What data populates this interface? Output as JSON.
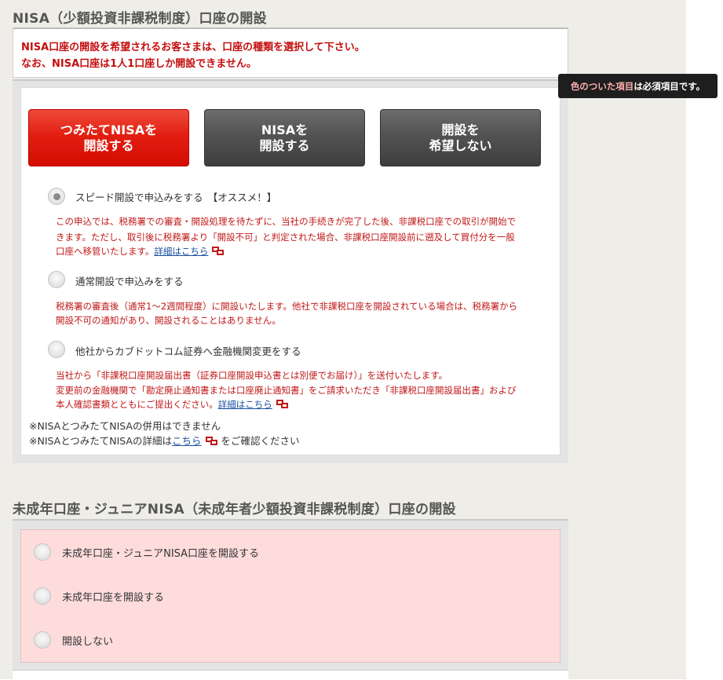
{
  "nisa_section": {
    "title": "NISA（少額投資非課税制度）口座の開設",
    "notice_line1": "NISA口座の開設を希望されるお客さまは、口座の種類を選択して下さい。",
    "notice_line2": "なお、NISA口座は1人1口座しか開設できません。",
    "buttons": {
      "tsumitate": "つみたてNISAを\n開設する",
      "nisa": "NISAを\n開設する",
      "none": "開設を\n希望しない"
    },
    "options": [
      {
        "label": "スピード開設で申込みをする　【オススメ！】",
        "checked": true,
        "desc_lines": [
          "この申込では、税務署での審査・開設処理を待たずに、当社の手続きが完了した後、非課税口座での取引が開始で",
          "きます。ただし、取引後に税務署より「開設不可」と判定された場合、非課税口座開設前に遡及して買付分を一般",
          "口座へ移管いたします。"
        ],
        "link": "詳細はこちら"
      },
      {
        "label": "通常開設で申込みをする",
        "checked": false,
        "desc_lines": [
          "税務署の審査後（通常1～2週間程度）に開設いたします。他社で非課税口座を開設されている場合は、税務署から",
          "開設不可の通知があり、開設されることはありません。"
        ]
      },
      {
        "label": "他社からカブドットコム証券へ金融機関変更をする",
        "checked": false,
        "desc_lines": [
          "当社から「非課税口座開設届出書（証券口座開設申込書とは別便でお届け）」を送付いたします。",
          "変更前の金融機関で「勘定廃止通知書または口座廃止通知書」をご請求いただき「非課税口座開設届出書」および",
          "本人確認書類とともにご提出ください。"
        ],
        "link": "詳細はこちら"
      }
    ],
    "note1": "※NISAとつみたてNISAの併用はできません",
    "note2_prefix": "※NISAとつみたてNISAの詳細は",
    "note2_link": "こちら",
    "note2_suffix": "をご確認ください"
  },
  "tooltip": {
    "highlight": "色のついた項目",
    "rest": "は必須項目です。"
  },
  "junior_section": {
    "title": "未成年口座・ジュニアNISA（未成年者少額投資非課税制度）口座の開設",
    "options": [
      {
        "label": "未成年口座・ジュニアNISA口座を開設する"
      },
      {
        "label": "未成年口座を開設する"
      },
      {
        "label": "開設しない"
      }
    ]
  },
  "colors": {
    "accent_red": "#d40b00",
    "dark_button": "#555555",
    "required_pink": "#ffdcdc",
    "page_bg": "#efede7"
  },
  "icons": [
    "external-window-icon",
    "radio-icon"
  ]
}
